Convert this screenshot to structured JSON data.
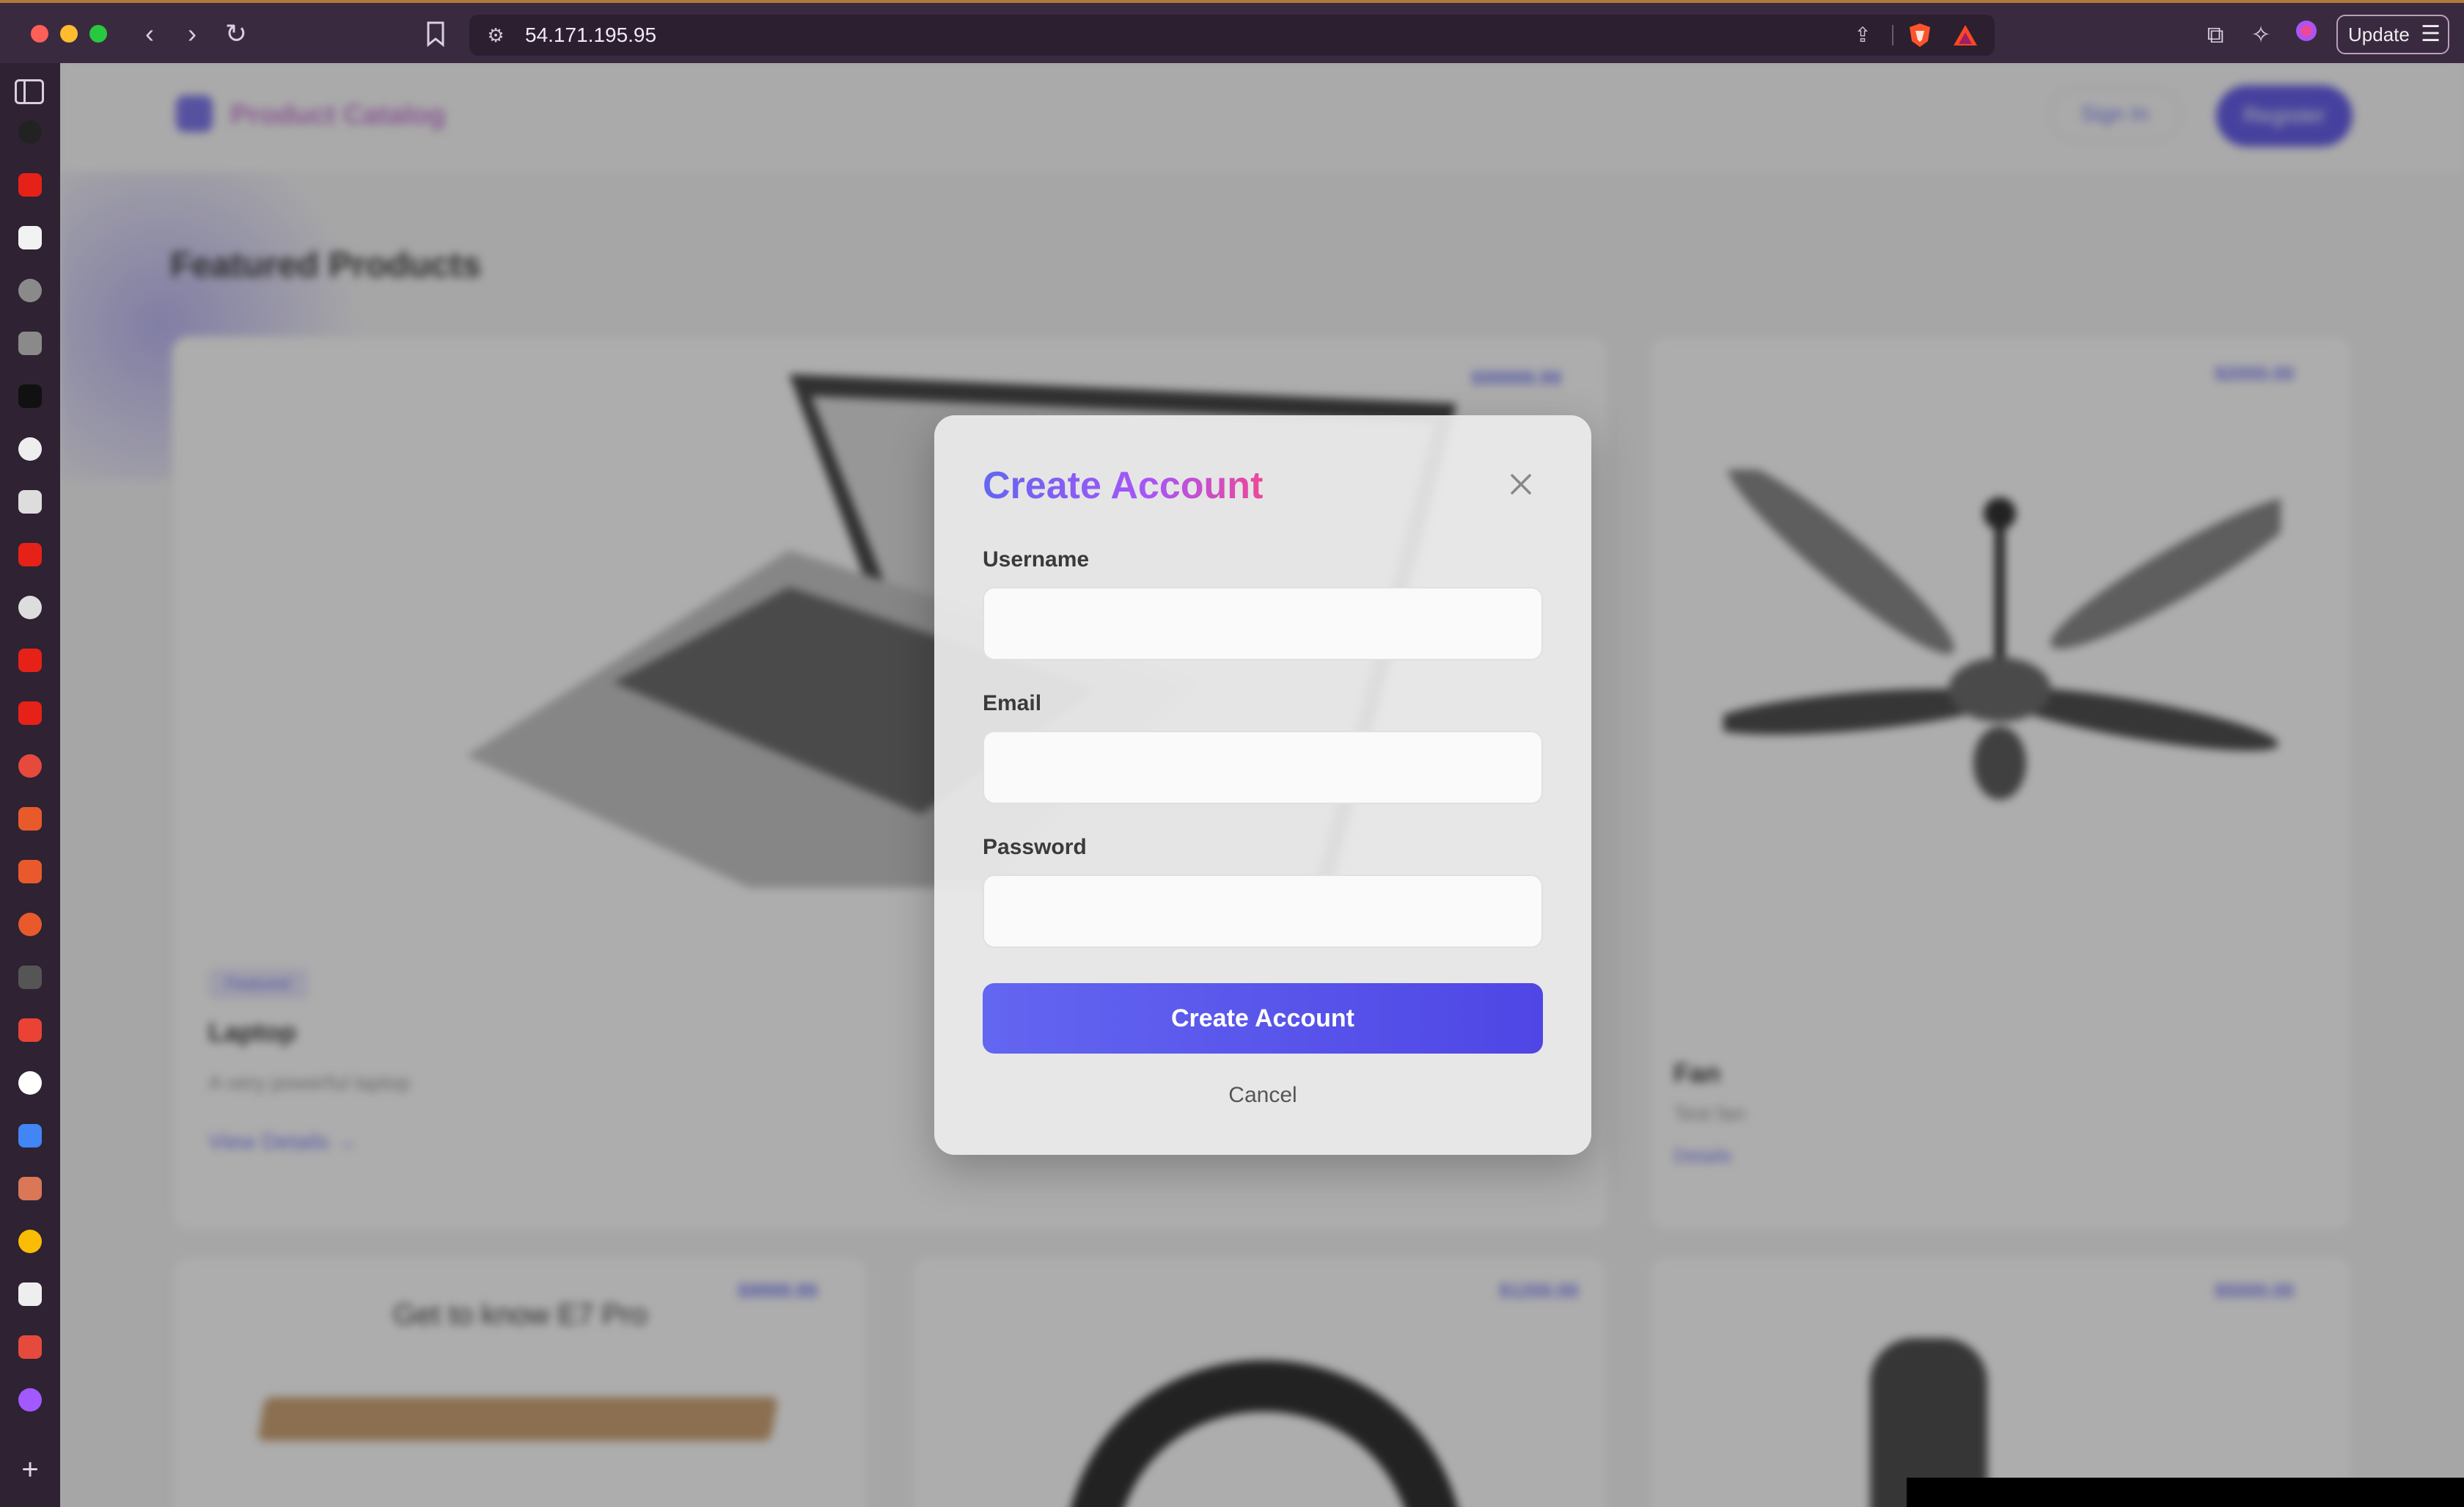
{
  "browser": {
    "url": "54.171.195.95",
    "update_label": "Update",
    "icons": {
      "back": "chevron-left-icon",
      "forward": "chevron-right-icon",
      "reload": "reload-icon",
      "bookmark": "bookmark-icon",
      "site_settings": "site-settings-icon",
      "share": "share-icon",
      "brave_shield": "brave-shield-icon",
      "brave_rewards": "brave-rewards-icon",
      "extensions": "extensions-icon",
      "leo": "leo-ai-icon",
      "profile": "profile-icon",
      "menu": "hamburger-menu-icon"
    }
  },
  "sidebar": {
    "items": [
      {
        "name": "sidebar-item-threads",
        "color": "#222222"
      },
      {
        "name": "sidebar-item-youtube-1",
        "color": "#e62117"
      },
      {
        "name": "sidebar-item-tab",
        "color": "#f2f2f2"
      },
      {
        "name": "sidebar-item-globe-1",
        "color": "#8a8a8a"
      },
      {
        "name": "sidebar-item-globe-2",
        "color": "#8a8a8a"
      },
      {
        "name": "sidebar-item-notion-like",
        "color": "#111111"
      },
      {
        "name": "sidebar-item-openai",
        "color": "#eeeeee"
      },
      {
        "name": "sidebar-item-github",
        "color": "#dddddd"
      },
      {
        "name": "sidebar-item-youtube-2",
        "color": "#e62117"
      },
      {
        "name": "sidebar-item-wordpress",
        "color": "#dddddd"
      },
      {
        "name": "sidebar-item-youtube-3",
        "color": "#e62117"
      },
      {
        "name": "sidebar-item-youtube-4",
        "color": "#e62117"
      },
      {
        "name": "sidebar-item-red-1",
        "color": "#e64a3c"
      },
      {
        "name": "sidebar-item-red-2",
        "color": "#e85a2c"
      },
      {
        "name": "sidebar-item-red-3",
        "color": "#e85a2c"
      },
      {
        "name": "sidebar-item-red-4",
        "color": "#e85a2c"
      },
      {
        "name": "sidebar-item-loading",
        "color": "#555555"
      },
      {
        "name": "sidebar-item-gmail",
        "color": "#ea4335"
      },
      {
        "name": "sidebar-item-notion",
        "color": "#ffffff"
      },
      {
        "name": "sidebar-item-docs",
        "color": "#4285f4"
      },
      {
        "name": "sidebar-item-claude",
        "color": "#d97757"
      },
      {
        "name": "sidebar-item-chrome",
        "color": "#fbbc05"
      },
      {
        "name": "sidebar-item-openai-2",
        "color": "#eeeeee"
      },
      {
        "name": "sidebar-item-link",
        "color": "#e64a3c"
      },
      {
        "name": "sidebar-item-figma",
        "color": "#a259ff"
      }
    ]
  },
  "site": {
    "logo_text": "Product Catalog",
    "signin_label": "Sign In",
    "register_label": "Register",
    "featured_title": "Featured Products",
    "cards": {
      "laptop": {
        "price": "$99999.99",
        "badge": "Featured",
        "name": "Laptop",
        "desc": "A very powerful laptop",
        "link": "View Details →"
      },
      "fan": {
        "price": "$2000.00",
        "name": "Fan",
        "desc": "Test fan",
        "link": "Details"
      },
      "desk": {
        "price": "$9999.99",
        "title": "Get to know E7 Pro"
      },
      "headphones": {
        "price": "$1200.00"
      },
      "chair": {
        "price": "$5000.00"
      }
    }
  },
  "modal": {
    "title": "Create Account",
    "username_label": "Username",
    "username_value": "",
    "email_label": "Email",
    "email_value": "",
    "password_label": "Password",
    "password_value": "",
    "submit_label": "Create Account",
    "cancel_label": "Cancel"
  },
  "colors": {
    "accent": "#6366f1",
    "title_gradient": [
      "#6366f1",
      "#a855f7",
      "#ec4899"
    ]
  }
}
